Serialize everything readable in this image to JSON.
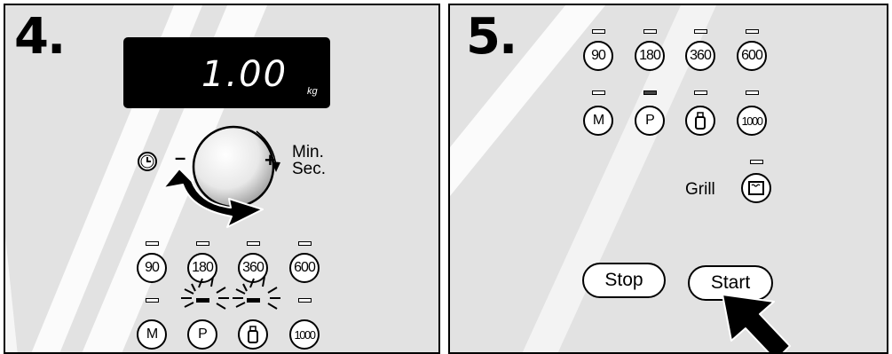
{
  "step4": {
    "number": "4.",
    "display": {
      "value": "1.00",
      "unit": "kg"
    },
    "dial": {
      "minus": "–",
      "plus": "+",
      "label_line1": "Min.",
      "label_line2": "Sec."
    },
    "timer_icon": "clock-icon",
    "power_buttons": [
      "90",
      "180",
      "360",
      "600"
    ],
    "mode_buttons": [
      "M",
      "P",
      "",
      "1000"
    ]
  },
  "step5": {
    "number": "5.",
    "power_buttons": [
      "90",
      "180",
      "360",
      "600"
    ],
    "mode_buttons": [
      "M",
      "P",
      "",
      "1000"
    ],
    "grill_label": "Grill",
    "stop_label": "Stop",
    "start_label": "Start"
  }
}
